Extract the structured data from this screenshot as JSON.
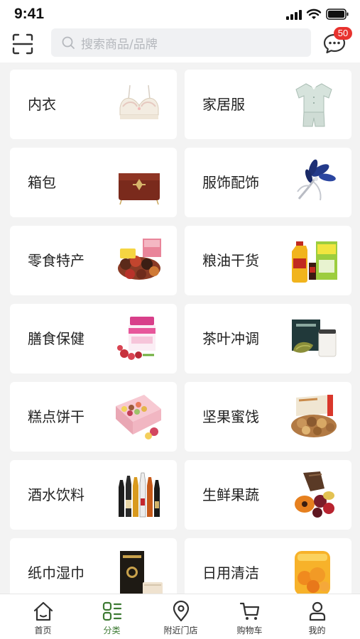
{
  "status_bar": {
    "time": "9:41"
  },
  "header": {
    "search_placeholder": "搜索商品/品牌",
    "message_badge": "50"
  },
  "categories": [
    {
      "label": "内衣",
      "icon": "bra-image"
    },
    {
      "label": "家居服",
      "icon": "loungewear-image"
    },
    {
      "label": "箱包",
      "icon": "handbag-image"
    },
    {
      "label": "服饰配饰",
      "icon": "brooch-image"
    },
    {
      "label": "零食特产",
      "icon": "snacks-image"
    },
    {
      "label": "粮油干货",
      "icon": "cooking-oil-image"
    },
    {
      "label": "膳食保健",
      "icon": "supplement-jar-image"
    },
    {
      "label": "茶叶冲调",
      "icon": "tea-set-image"
    },
    {
      "label": "糕点饼干",
      "icon": "macaron-box-image"
    },
    {
      "label": "坚果蜜饯",
      "icon": "nuts-box-image"
    },
    {
      "label": "酒水饮料",
      "icon": "wine-bottles-image"
    },
    {
      "label": "生鲜果蔬",
      "icon": "fresh-fruit-image"
    },
    {
      "label": "纸巾湿巾",
      "icon": "tissue-box-image"
    },
    {
      "label": "日用清洁",
      "icon": "cleaning-product-image"
    }
  ],
  "tabbar": [
    {
      "label": "首页",
      "icon": "home-icon",
      "active": false
    },
    {
      "label": "分类",
      "icon": "category-icon",
      "active": true
    },
    {
      "label": "附近门店",
      "icon": "location-pin-icon",
      "active": false
    },
    {
      "label": "购物车",
      "icon": "cart-icon",
      "active": false
    },
    {
      "label": "我的",
      "icon": "profile-icon",
      "active": false
    }
  ],
  "colors": {
    "accent_green": "#3d7a33",
    "badge_red": "#e8322e",
    "page_bg": "#f3f3f3"
  }
}
